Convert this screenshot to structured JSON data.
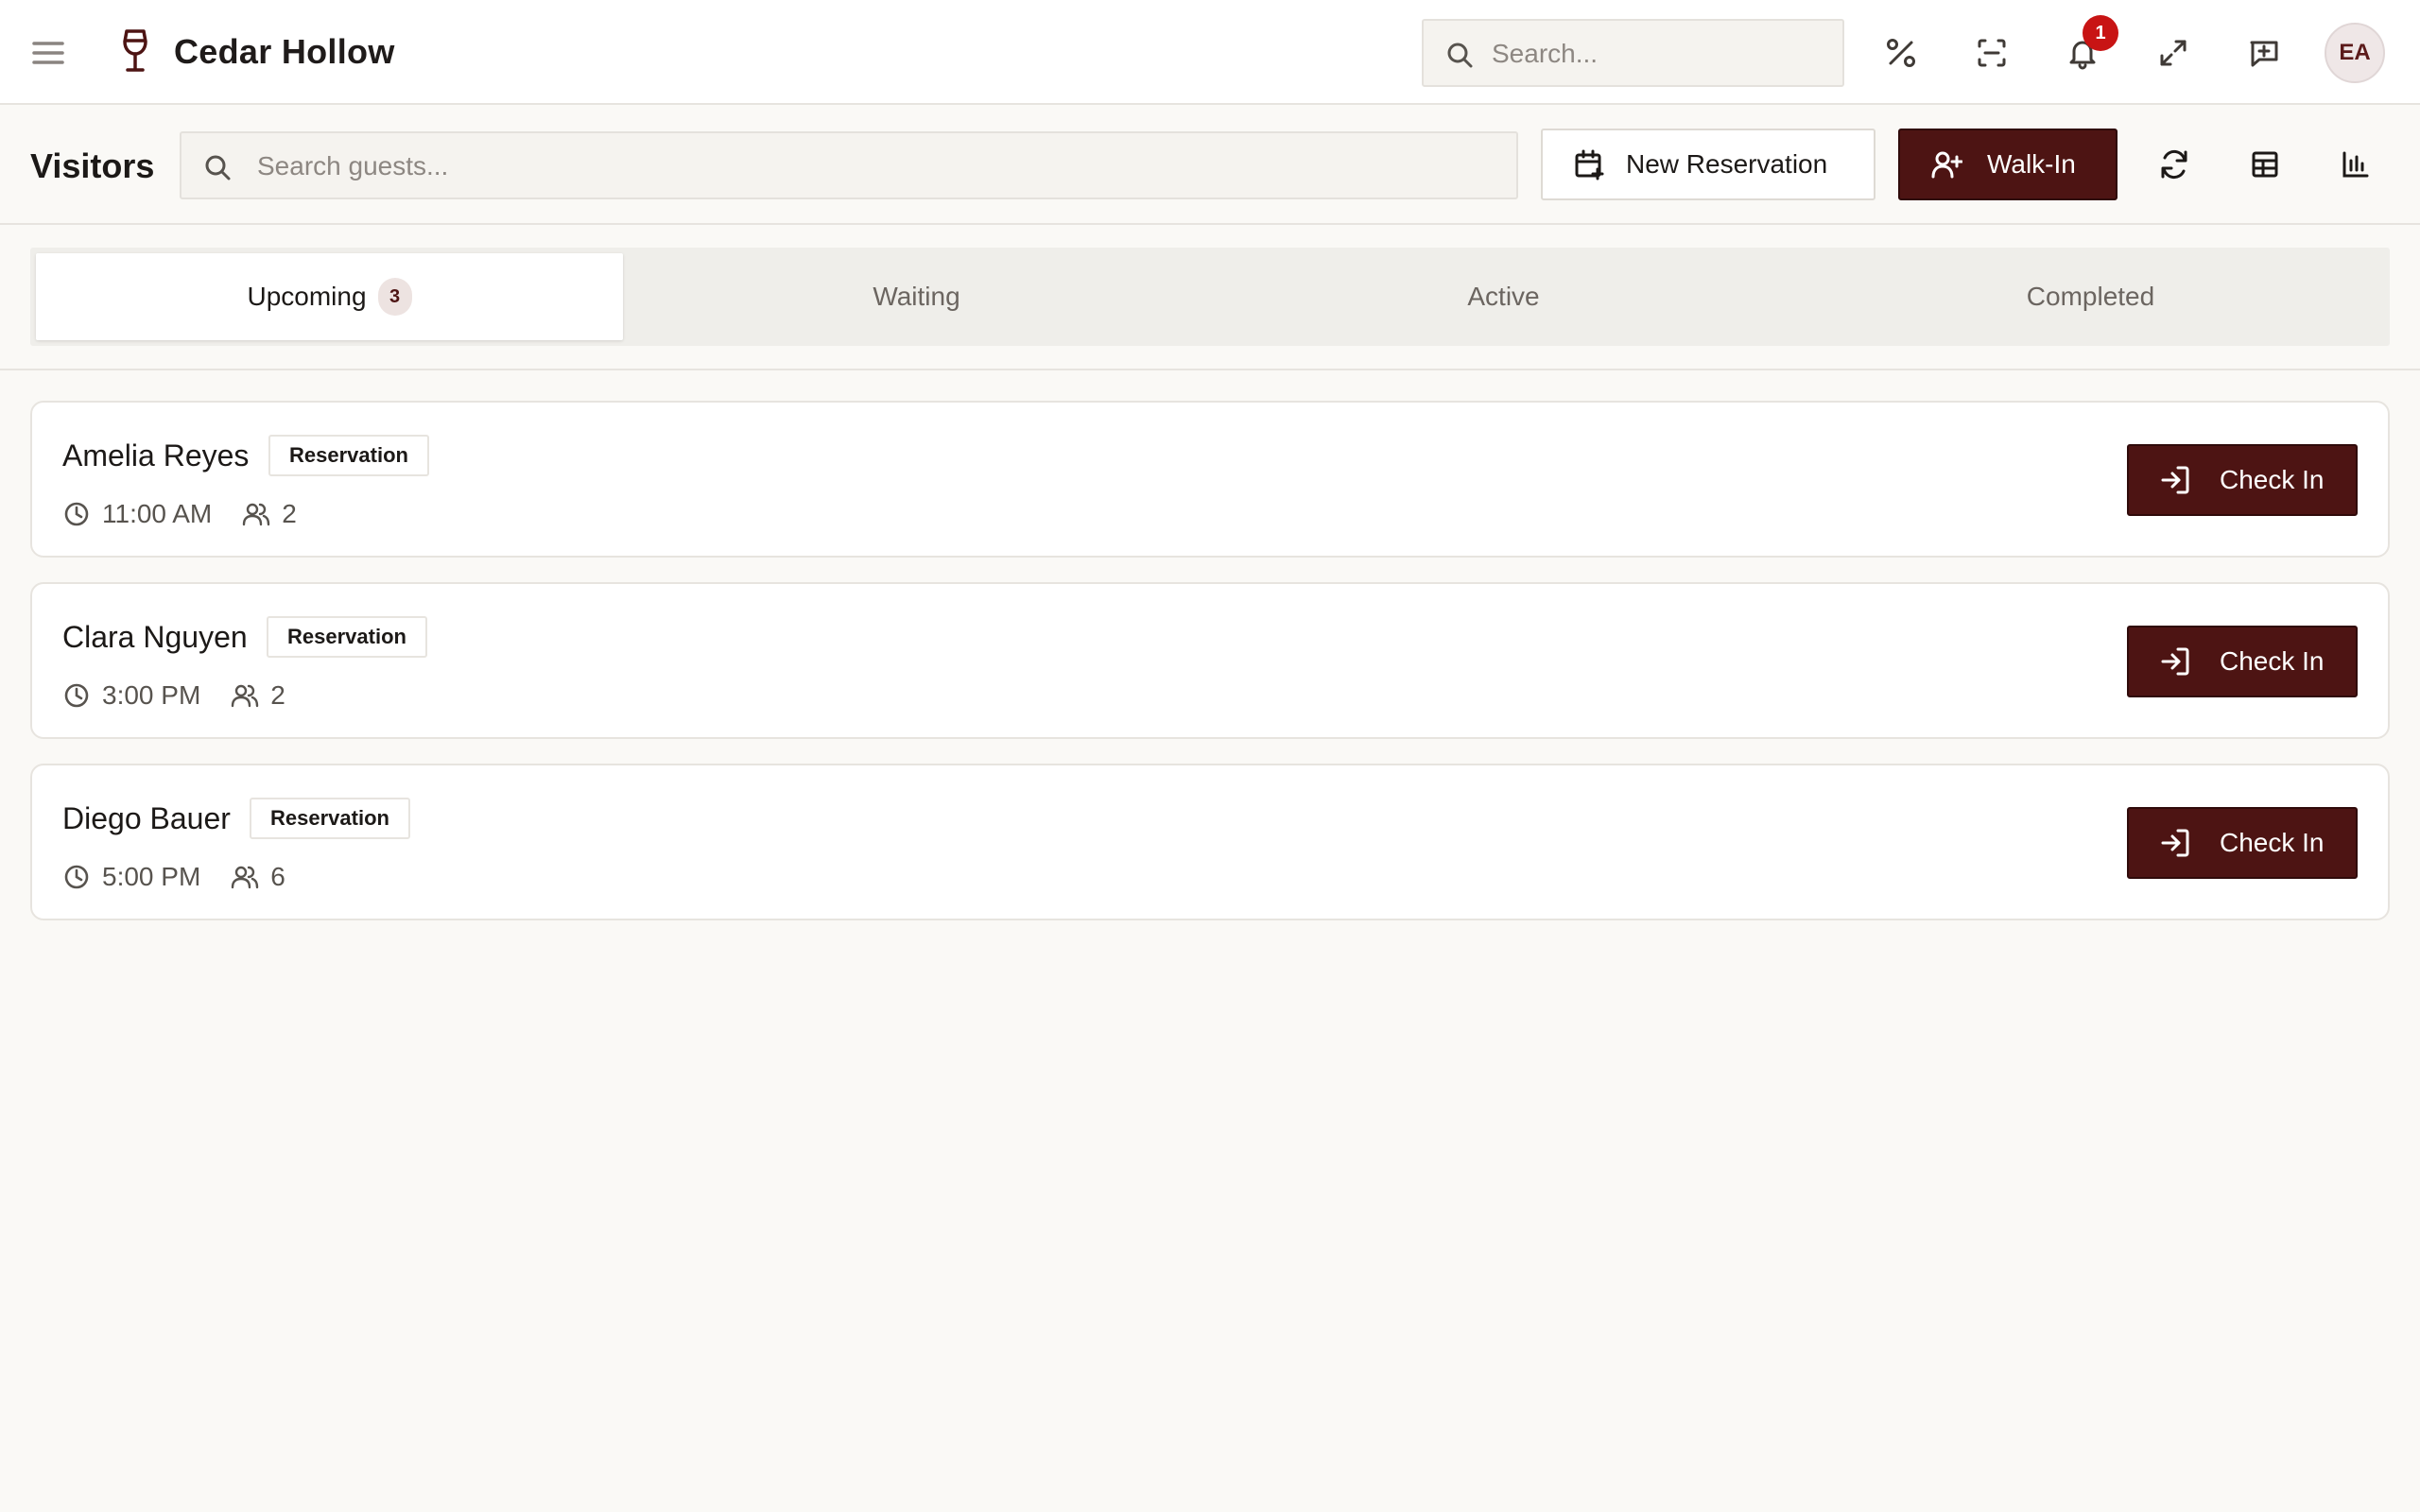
{
  "colors": {
    "accent": "#4d1413",
    "badge": "#c81414",
    "background": "#faf9f6"
  },
  "app": {
    "name": "Cedar Hollow",
    "logo_icon": "wine-glass-icon"
  },
  "header": {
    "search_placeholder": "Search...",
    "notification_count": "1",
    "user_initials": "EA",
    "icons": [
      "menu-icon",
      "percent-icon",
      "scan-icon",
      "bell-icon",
      "expand-icon",
      "feedback-icon"
    ]
  },
  "toolbar": {
    "title": "Visitors",
    "search_placeholder": "Search guests...",
    "new_reservation_label": "New Reservation",
    "walk_in_label": "Walk-In",
    "icons": [
      "refresh-icon",
      "table-layout-icon",
      "bar-chart-icon"
    ]
  },
  "tabs": [
    {
      "label": "Upcoming",
      "count": "3",
      "active": true
    },
    {
      "label": "Waiting"
    },
    {
      "label": "Active"
    },
    {
      "label": "Completed"
    }
  ],
  "visitors": [
    {
      "name": "Amelia Reyes",
      "type": "Reservation",
      "time": "11:00 AM",
      "party_size": "2",
      "action": "Check In"
    },
    {
      "name": "Clara Nguyen",
      "type": "Reservation",
      "time": "3:00 PM",
      "party_size": "2",
      "action": "Check In"
    },
    {
      "name": "Diego Bauer",
      "type": "Reservation",
      "time": "5:00 PM",
      "party_size": "6",
      "action": "Check In"
    }
  ]
}
